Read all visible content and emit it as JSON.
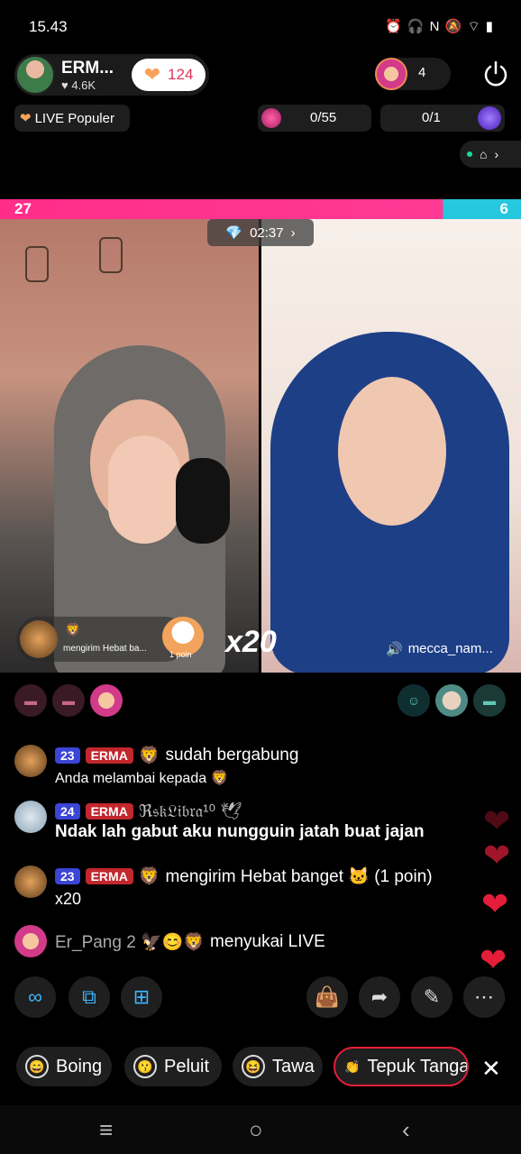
{
  "status": {
    "time": "15.43",
    "icons": "⏰ 🎧 N 🔕 ⌔ ▮"
  },
  "host": {
    "name": "ERM...",
    "likes": "♥ 4.6K",
    "follow_count": "124"
  },
  "viewers": {
    "count": "4"
  },
  "popular": {
    "label": "LIVE Populer"
  },
  "scores": {
    "left": "0/55",
    "right": "0/1"
  },
  "battle": {
    "left_score": "27",
    "right_score": "6",
    "timer": "02:37"
  },
  "video": {
    "gift_text": "mengirim Hebat ba...",
    "gift_poin": "1 poin",
    "combo": "x20",
    "right_user": "mecca_nam..."
  },
  "chat": [
    {
      "level": "23",
      "fan": "ERMA",
      "user": "🦁",
      "text": "sudah bergabung",
      "sub": "Anda melambai kepada 🦁"
    },
    {
      "level": "24",
      "fan": "ERMA",
      "user": "ℜ𝔰𝔨𝔏𝔦𝔟𝔯𝔞¹⁰ 🕊",
      "text": "",
      "sub": "Ndak lah gabut aku nungguin jatah buat jajan"
    },
    {
      "level": "23",
      "fan": "ERMA",
      "user": "🦁",
      "text": "mengirim Hebat banget 🐱 (1 poin)",
      "sub": "x20"
    },
    {
      "user": "Er_Pang 2 🦅😊🦁",
      "text": "menyukai LIVE"
    }
  ],
  "reactions": [
    {
      "label": "Boing",
      "emoji": "😄"
    },
    {
      "label": "Peluit",
      "emoji": "😗"
    },
    {
      "label": "Tawa",
      "emoji": "😆"
    },
    {
      "label": "Tepuk Tanga",
      "emoji": "👏"
    }
  ],
  "colors": {
    "accent": "#ff2d88",
    "opponent": "#25c8de",
    "heart": "#e41e3a",
    "level": "#3b45d6"
  }
}
